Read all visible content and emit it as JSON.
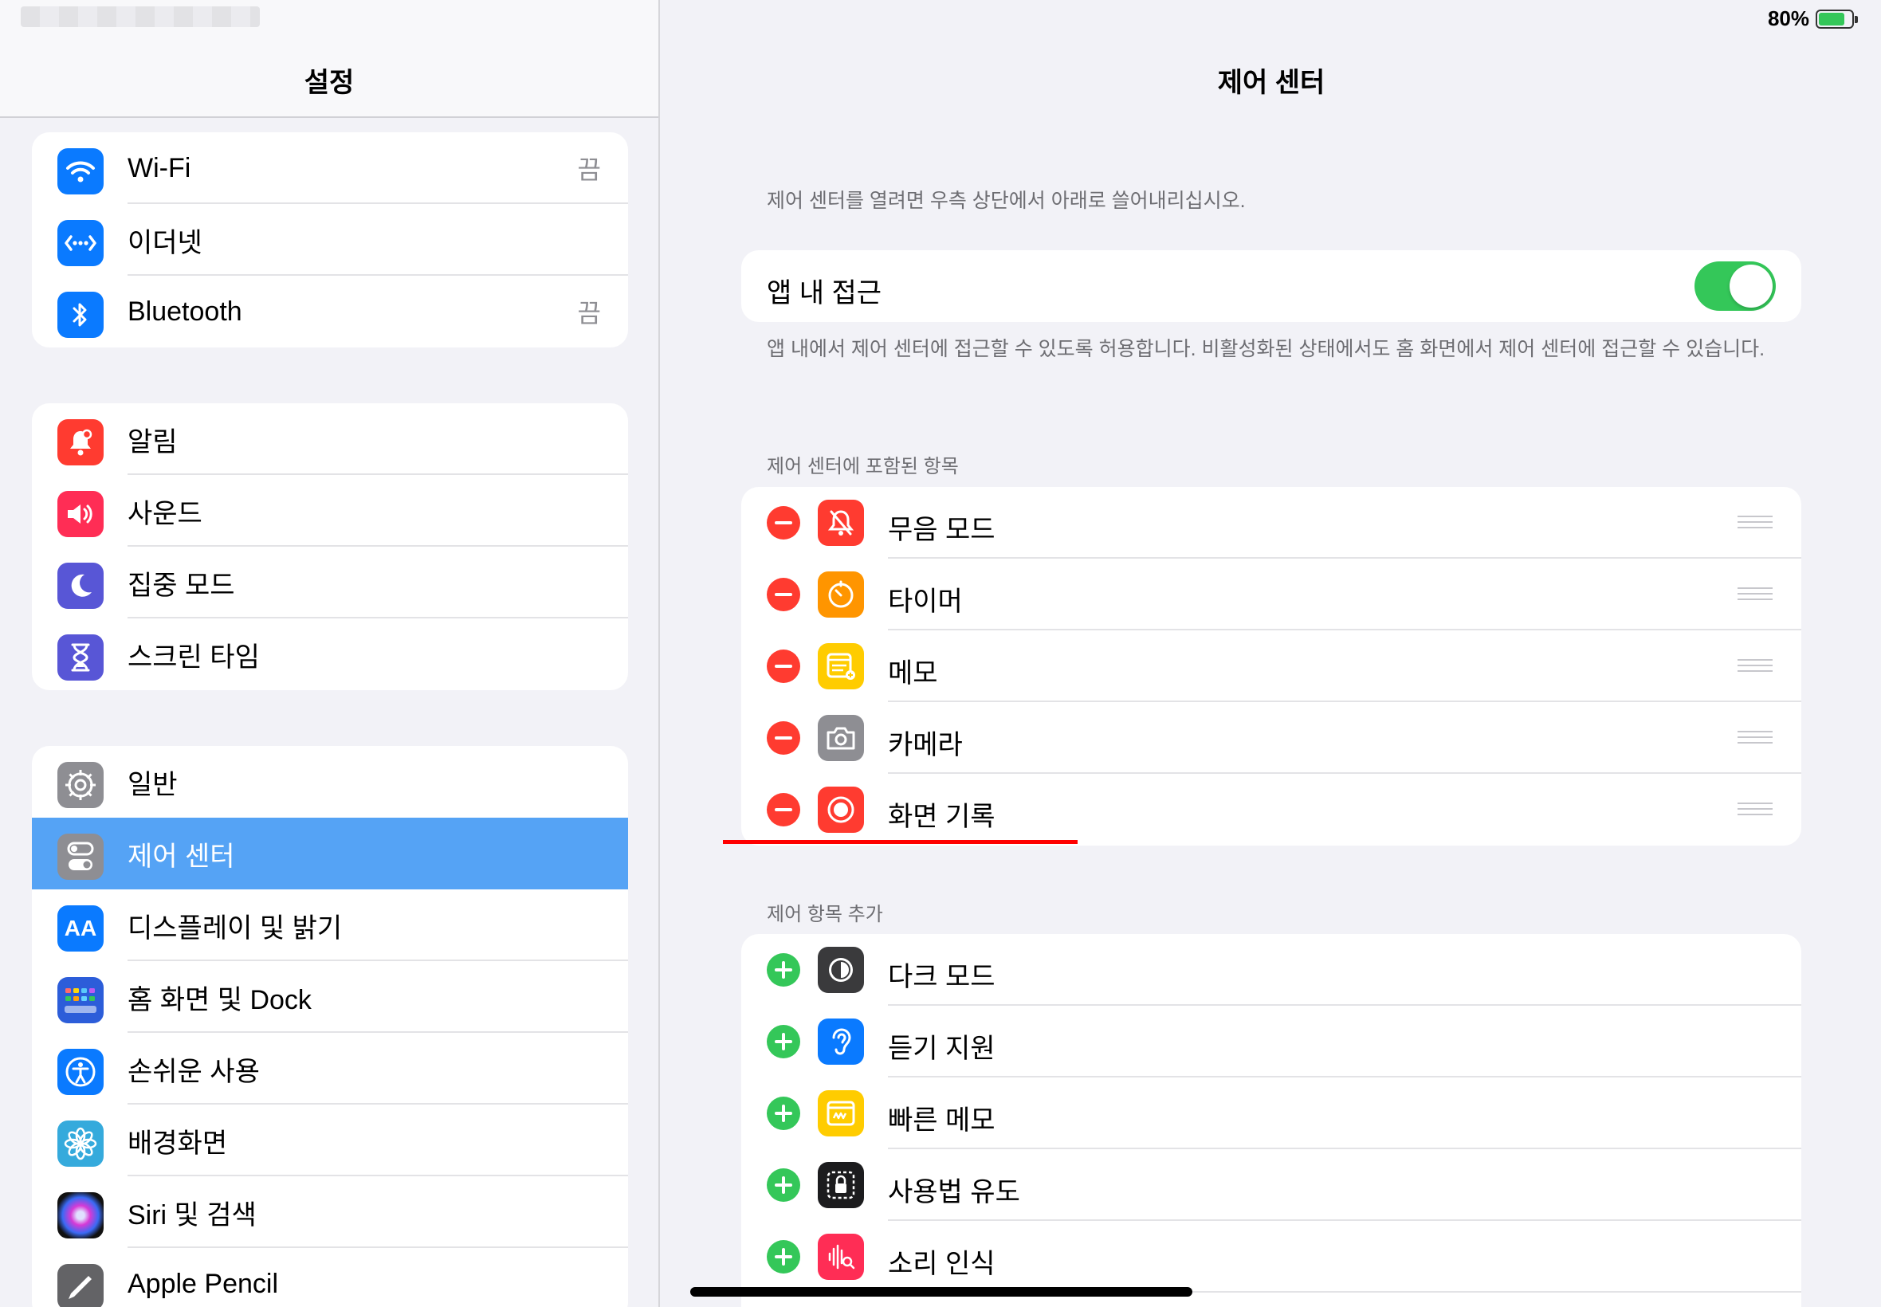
{
  "status": {
    "battery_percent": "80%",
    "battery_level": 0.8
  },
  "sidebar": {
    "title": "설정",
    "group1": [
      {
        "label": "Wi-Fi",
        "value": "끔",
        "icon": "wifi-icon",
        "color": "#0a7aff"
      },
      {
        "label": "이더넷",
        "value": "",
        "icon": "ethernet-icon",
        "color": "#0a7aff"
      },
      {
        "label": "Bluetooth",
        "value": "끔",
        "icon": "bluetooth-icon",
        "color": "#0a7aff"
      }
    ],
    "group2": [
      {
        "label": "알림",
        "icon": "bell-icon",
        "color": "#ff3b30"
      },
      {
        "label": "사운드",
        "icon": "speaker-icon",
        "color": "#ff2d55"
      },
      {
        "label": "집중 모드",
        "icon": "moon-icon",
        "color": "#5856d6"
      },
      {
        "label": "스크린 타임",
        "icon": "hourglass-icon",
        "color": "#5856d6"
      }
    ],
    "group3": [
      {
        "label": "일반",
        "icon": "gear-icon",
        "color": "#8e8e93"
      },
      {
        "label": "제어 센터",
        "icon": "switches-icon",
        "color": "#8e8e93",
        "selected": true
      },
      {
        "label": "디스플레이 및 밝기",
        "icon": "text-size-icon",
        "color": "#0a7aff"
      },
      {
        "label": "홈 화면 및 Dock",
        "icon": "home-grid-icon",
        "color": "#2c5dd9"
      },
      {
        "label": "손쉬운 사용",
        "icon": "accessibility-icon",
        "color": "#0a7aff"
      },
      {
        "label": "배경화면",
        "icon": "flower-icon",
        "color": "#35aadc"
      },
      {
        "label": "Siri 및 검색",
        "icon": "siri-icon",
        "color": "#222"
      },
      {
        "label": "Apple Pencil",
        "icon": "pencil-icon",
        "color": "#636366"
      }
    ]
  },
  "main": {
    "title": "제어 센터",
    "intro": "제어 센터를 열려면 우측 상단에서 아래로 쓸어내리십시오.",
    "access_in_apps": {
      "label": "앱 내 접근",
      "enabled": true,
      "footer": "앱 내에서 제어 센터에 접근할 수 있도록 허용합니다. 비활성화된 상태에서도 홈 화면에서 제어 센터에 접근할 수 있습니다."
    },
    "included_header": "제어 센터에 포함된 항목",
    "included": [
      {
        "label": "무음 모드",
        "icon": "bell-slash-icon",
        "color": "#ff3b30"
      },
      {
        "label": "타이머",
        "icon": "timer-icon",
        "color": "#ff9500"
      },
      {
        "label": "메모",
        "icon": "notes-icon",
        "color": "#ffcc00"
      },
      {
        "label": "카메라",
        "icon": "camera-icon",
        "color": "#8e8e93"
      },
      {
        "label": "화면 기록",
        "icon": "record-icon",
        "color": "#ff3b30"
      }
    ],
    "more_header": "제어 항목 추가",
    "more": [
      {
        "label": "다크 모드",
        "icon": "dark-mode-icon",
        "color": "#3a3a3c"
      },
      {
        "label": "듣기 지원",
        "icon": "ear-icon",
        "color": "#0a7aff"
      },
      {
        "label": "빠른 메모",
        "icon": "quick-note-icon",
        "color": "#ffcc00"
      },
      {
        "label": "사용법 유도",
        "icon": "lock-icon",
        "color": "#1c1c1e"
      },
      {
        "label": "소리 인식",
        "icon": "waveform-icon",
        "color": "#ff2d55"
      }
    ]
  }
}
